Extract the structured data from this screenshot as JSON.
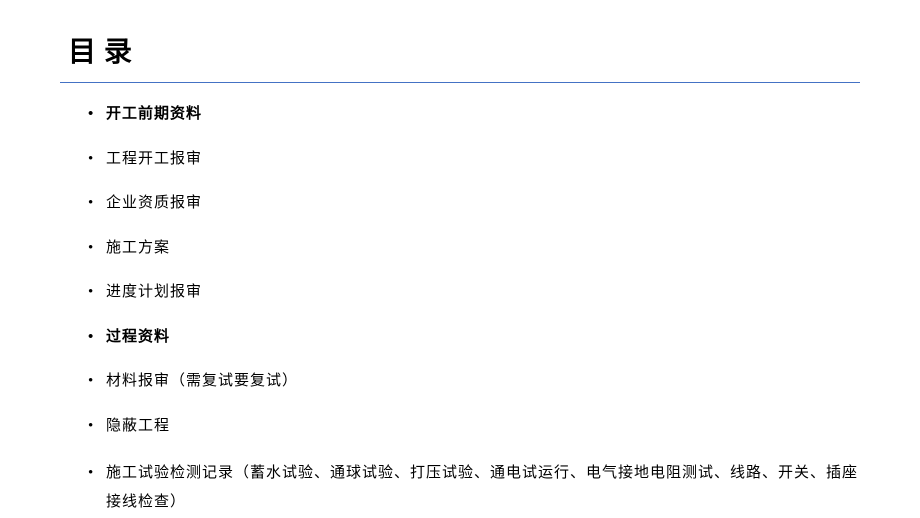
{
  "title": "目录",
  "items": [
    {
      "text": "开工前期资料",
      "bold": true
    },
    {
      "text": "工程开工报审",
      "bold": false
    },
    {
      "text": "企业资质报审",
      "bold": false
    },
    {
      "text": "施工方案",
      "bold": false
    },
    {
      "text": "进度计划报审",
      "bold": false
    },
    {
      "text": "过程资料",
      "bold": true
    },
    {
      "text": "材料报审（需复试要复试）",
      "bold": false
    },
    {
      "text": "隐蔽工程",
      "bold": false
    },
    {
      "text": "施工试验检测记录（蓄水试验、通球试验、打压试验、通电试运行、电气接地电阻测试、线路、开关、插座接线检查）",
      "bold": false
    }
  ]
}
